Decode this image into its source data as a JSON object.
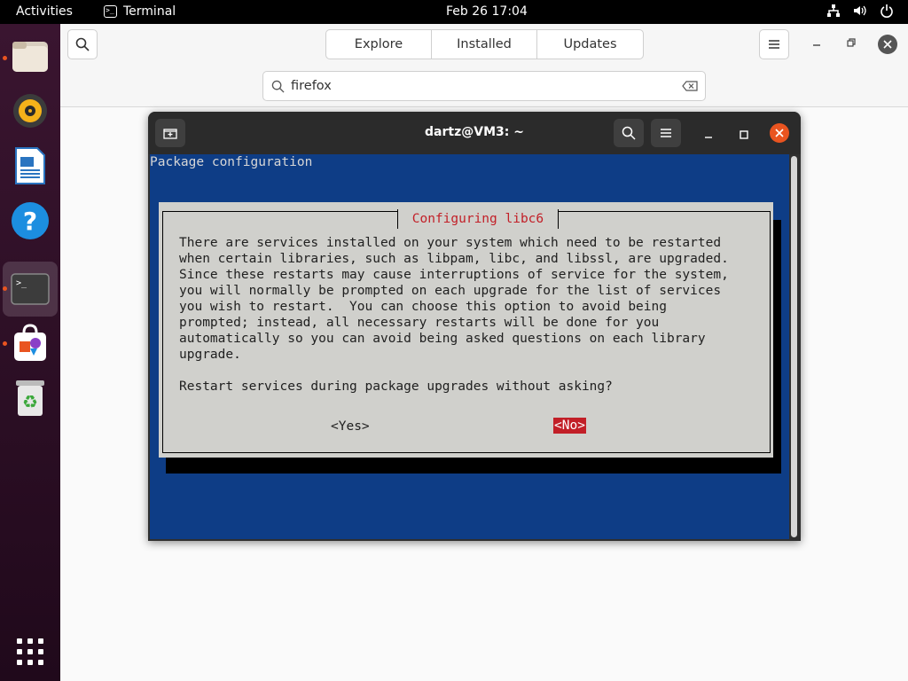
{
  "topbar": {
    "activities": "Activities",
    "app_name": "Terminal",
    "clock": "Feb 26  17:04"
  },
  "dock": {
    "items": [
      "files-icon",
      "rhythmbox-icon",
      "writer-icon",
      "help-icon",
      "terminal-icon",
      "software-icon",
      "trash-icon",
      "app-grid-icon"
    ]
  },
  "software_center": {
    "tabs": [
      "Explore",
      "Installed",
      "Updates"
    ],
    "search_value": "firefox"
  },
  "terminal": {
    "title": "dartz@VM3: ~",
    "package_config_header": "Package configuration",
    "dialog": {
      "title": " Configuring libc6 ",
      "lines": [
        "There are services installed on your system which need to be restarted",
        "when certain libraries, such as libpam, libc, and libssl, are upgraded.",
        "Since these restarts may cause interruptions of service for the system,",
        "you will normally be prompted on each upgrade for the list of services",
        "you wish to restart.  You can choose this option to avoid being",
        "prompted; instead, all necessary restarts will be done for you",
        "automatically so you can avoid being asked questions on each library",
        "upgrade."
      ],
      "question": "Restart services during package upgrades without asking?",
      "yes_label": "<Yes>",
      "no_label": "<No>"
    }
  },
  "colors": {
    "terminal_bg": "#0e3d86",
    "dialog_bg": "#d0d0cc",
    "accent_red": "#c21f27",
    "ubuntu_orange": "#e95420"
  }
}
